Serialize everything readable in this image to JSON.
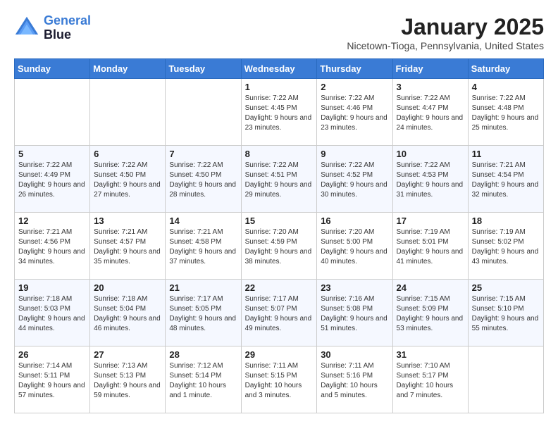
{
  "header": {
    "logo_line1": "General",
    "logo_line2": "Blue",
    "month": "January 2025",
    "location": "Nicetown-Tioga, Pennsylvania, United States"
  },
  "weekdays": [
    "Sunday",
    "Monday",
    "Tuesday",
    "Wednesday",
    "Thursday",
    "Friday",
    "Saturday"
  ],
  "weeks": [
    [
      {
        "day": "",
        "info": ""
      },
      {
        "day": "",
        "info": ""
      },
      {
        "day": "",
        "info": ""
      },
      {
        "day": "1",
        "info": "Sunrise: 7:22 AM\nSunset: 4:45 PM\nDaylight: 9 hours and 23 minutes."
      },
      {
        "day": "2",
        "info": "Sunrise: 7:22 AM\nSunset: 4:46 PM\nDaylight: 9 hours and 23 minutes."
      },
      {
        "day": "3",
        "info": "Sunrise: 7:22 AM\nSunset: 4:47 PM\nDaylight: 9 hours and 24 minutes."
      },
      {
        "day": "4",
        "info": "Sunrise: 7:22 AM\nSunset: 4:48 PM\nDaylight: 9 hours and 25 minutes."
      }
    ],
    [
      {
        "day": "5",
        "info": "Sunrise: 7:22 AM\nSunset: 4:49 PM\nDaylight: 9 hours and 26 minutes."
      },
      {
        "day": "6",
        "info": "Sunrise: 7:22 AM\nSunset: 4:50 PM\nDaylight: 9 hours and 27 minutes."
      },
      {
        "day": "7",
        "info": "Sunrise: 7:22 AM\nSunset: 4:50 PM\nDaylight: 9 hours and 28 minutes."
      },
      {
        "day": "8",
        "info": "Sunrise: 7:22 AM\nSunset: 4:51 PM\nDaylight: 9 hours and 29 minutes."
      },
      {
        "day": "9",
        "info": "Sunrise: 7:22 AM\nSunset: 4:52 PM\nDaylight: 9 hours and 30 minutes."
      },
      {
        "day": "10",
        "info": "Sunrise: 7:22 AM\nSunset: 4:53 PM\nDaylight: 9 hours and 31 minutes."
      },
      {
        "day": "11",
        "info": "Sunrise: 7:21 AM\nSunset: 4:54 PM\nDaylight: 9 hours and 32 minutes."
      }
    ],
    [
      {
        "day": "12",
        "info": "Sunrise: 7:21 AM\nSunset: 4:56 PM\nDaylight: 9 hours and 34 minutes."
      },
      {
        "day": "13",
        "info": "Sunrise: 7:21 AM\nSunset: 4:57 PM\nDaylight: 9 hours and 35 minutes."
      },
      {
        "day": "14",
        "info": "Sunrise: 7:21 AM\nSunset: 4:58 PM\nDaylight: 9 hours and 37 minutes."
      },
      {
        "day": "15",
        "info": "Sunrise: 7:20 AM\nSunset: 4:59 PM\nDaylight: 9 hours and 38 minutes."
      },
      {
        "day": "16",
        "info": "Sunrise: 7:20 AM\nSunset: 5:00 PM\nDaylight: 9 hours and 40 minutes."
      },
      {
        "day": "17",
        "info": "Sunrise: 7:19 AM\nSunset: 5:01 PM\nDaylight: 9 hours and 41 minutes."
      },
      {
        "day": "18",
        "info": "Sunrise: 7:19 AM\nSunset: 5:02 PM\nDaylight: 9 hours and 43 minutes."
      }
    ],
    [
      {
        "day": "19",
        "info": "Sunrise: 7:18 AM\nSunset: 5:03 PM\nDaylight: 9 hours and 44 minutes."
      },
      {
        "day": "20",
        "info": "Sunrise: 7:18 AM\nSunset: 5:04 PM\nDaylight: 9 hours and 46 minutes."
      },
      {
        "day": "21",
        "info": "Sunrise: 7:17 AM\nSunset: 5:05 PM\nDaylight: 9 hours and 48 minutes."
      },
      {
        "day": "22",
        "info": "Sunrise: 7:17 AM\nSunset: 5:07 PM\nDaylight: 9 hours and 49 minutes."
      },
      {
        "day": "23",
        "info": "Sunrise: 7:16 AM\nSunset: 5:08 PM\nDaylight: 9 hours and 51 minutes."
      },
      {
        "day": "24",
        "info": "Sunrise: 7:15 AM\nSunset: 5:09 PM\nDaylight: 9 hours and 53 minutes."
      },
      {
        "day": "25",
        "info": "Sunrise: 7:15 AM\nSunset: 5:10 PM\nDaylight: 9 hours and 55 minutes."
      }
    ],
    [
      {
        "day": "26",
        "info": "Sunrise: 7:14 AM\nSunset: 5:11 PM\nDaylight: 9 hours and 57 minutes."
      },
      {
        "day": "27",
        "info": "Sunrise: 7:13 AM\nSunset: 5:13 PM\nDaylight: 9 hours and 59 minutes."
      },
      {
        "day": "28",
        "info": "Sunrise: 7:12 AM\nSunset: 5:14 PM\nDaylight: 10 hours and 1 minute."
      },
      {
        "day": "29",
        "info": "Sunrise: 7:11 AM\nSunset: 5:15 PM\nDaylight: 10 hours and 3 minutes."
      },
      {
        "day": "30",
        "info": "Sunrise: 7:11 AM\nSunset: 5:16 PM\nDaylight: 10 hours and 5 minutes."
      },
      {
        "day": "31",
        "info": "Sunrise: 7:10 AM\nSunset: 5:17 PM\nDaylight: 10 hours and 7 minutes."
      },
      {
        "day": "",
        "info": ""
      }
    ]
  ]
}
